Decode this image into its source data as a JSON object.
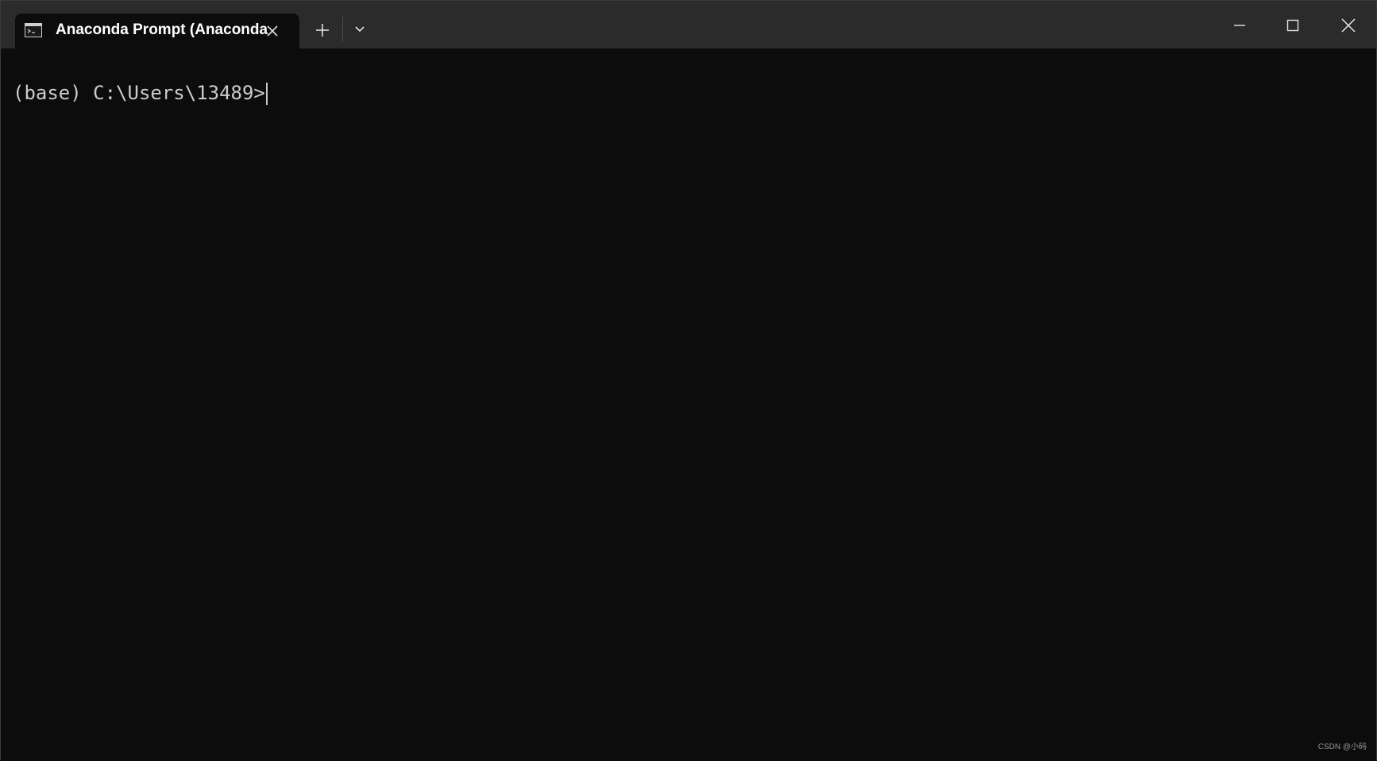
{
  "window": {
    "tab_title": "Anaconda Prompt (Anaconda",
    "tab_icon": "terminal-icon",
    "new_tab_icon": "plus-icon",
    "dropdown_icon": "chevron-down-icon",
    "controls": {
      "minimize_icon": "minimize-icon",
      "maximize_icon": "maximize-icon",
      "close_icon": "close-icon"
    }
  },
  "terminal": {
    "prompt": "(base) C:\\Users\\13489>",
    "background": "#0c0c0c",
    "foreground": "#cccccc"
  },
  "watermark": "CSDN @小码"
}
